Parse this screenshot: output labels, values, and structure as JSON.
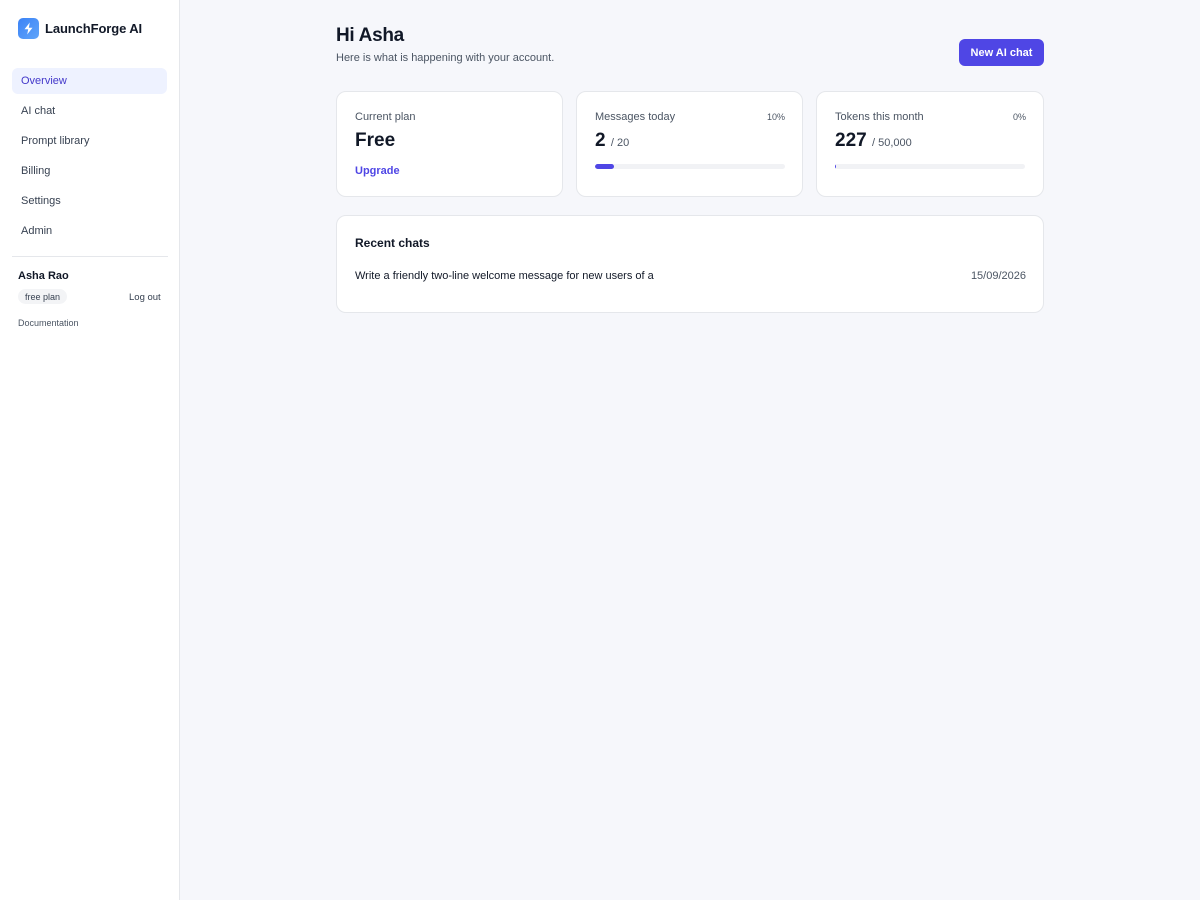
{
  "app": {
    "name": "LaunchForge AI"
  },
  "nav": {
    "items": [
      {
        "label": "Overview",
        "active": true
      },
      {
        "label": "AI chat"
      },
      {
        "label": "Prompt library"
      },
      {
        "label": "Billing"
      },
      {
        "label": "Settings"
      },
      {
        "label": "Admin"
      }
    ]
  },
  "user": {
    "name": "Asha Rao",
    "plan": "free plan",
    "logout": "Log out"
  },
  "footer": {
    "docs": "Documentation"
  },
  "header": {
    "greeting": "Hi Asha",
    "subtitle": "Here is what is happening with your account.",
    "new_chat_label": "New AI chat"
  },
  "cards": {
    "plan": {
      "label": "Current plan",
      "value": "Free",
      "action": "Upgrade"
    },
    "messages": {
      "label": "Messages today",
      "percent": "10%",
      "value": "2",
      "limit": "/ 20",
      "fraction": 0.1
    },
    "tokens": {
      "label": "Tokens this month",
      "percent": "0%",
      "value": "227",
      "limit": "/ 50,000",
      "fraction": 0.00454
    }
  },
  "recent": {
    "title": "Recent chats",
    "items": [
      {
        "title": "Write a friendly two-line welcome message for new users of a",
        "date": "15/09/2026"
      }
    ]
  },
  "colors": {
    "accent": "#4f46e5",
    "nav_active_bg": "#eef2ff",
    "page_bg": "#f6f7fb"
  },
  "icons": {
    "brand": "lightning-bolt-icon"
  }
}
